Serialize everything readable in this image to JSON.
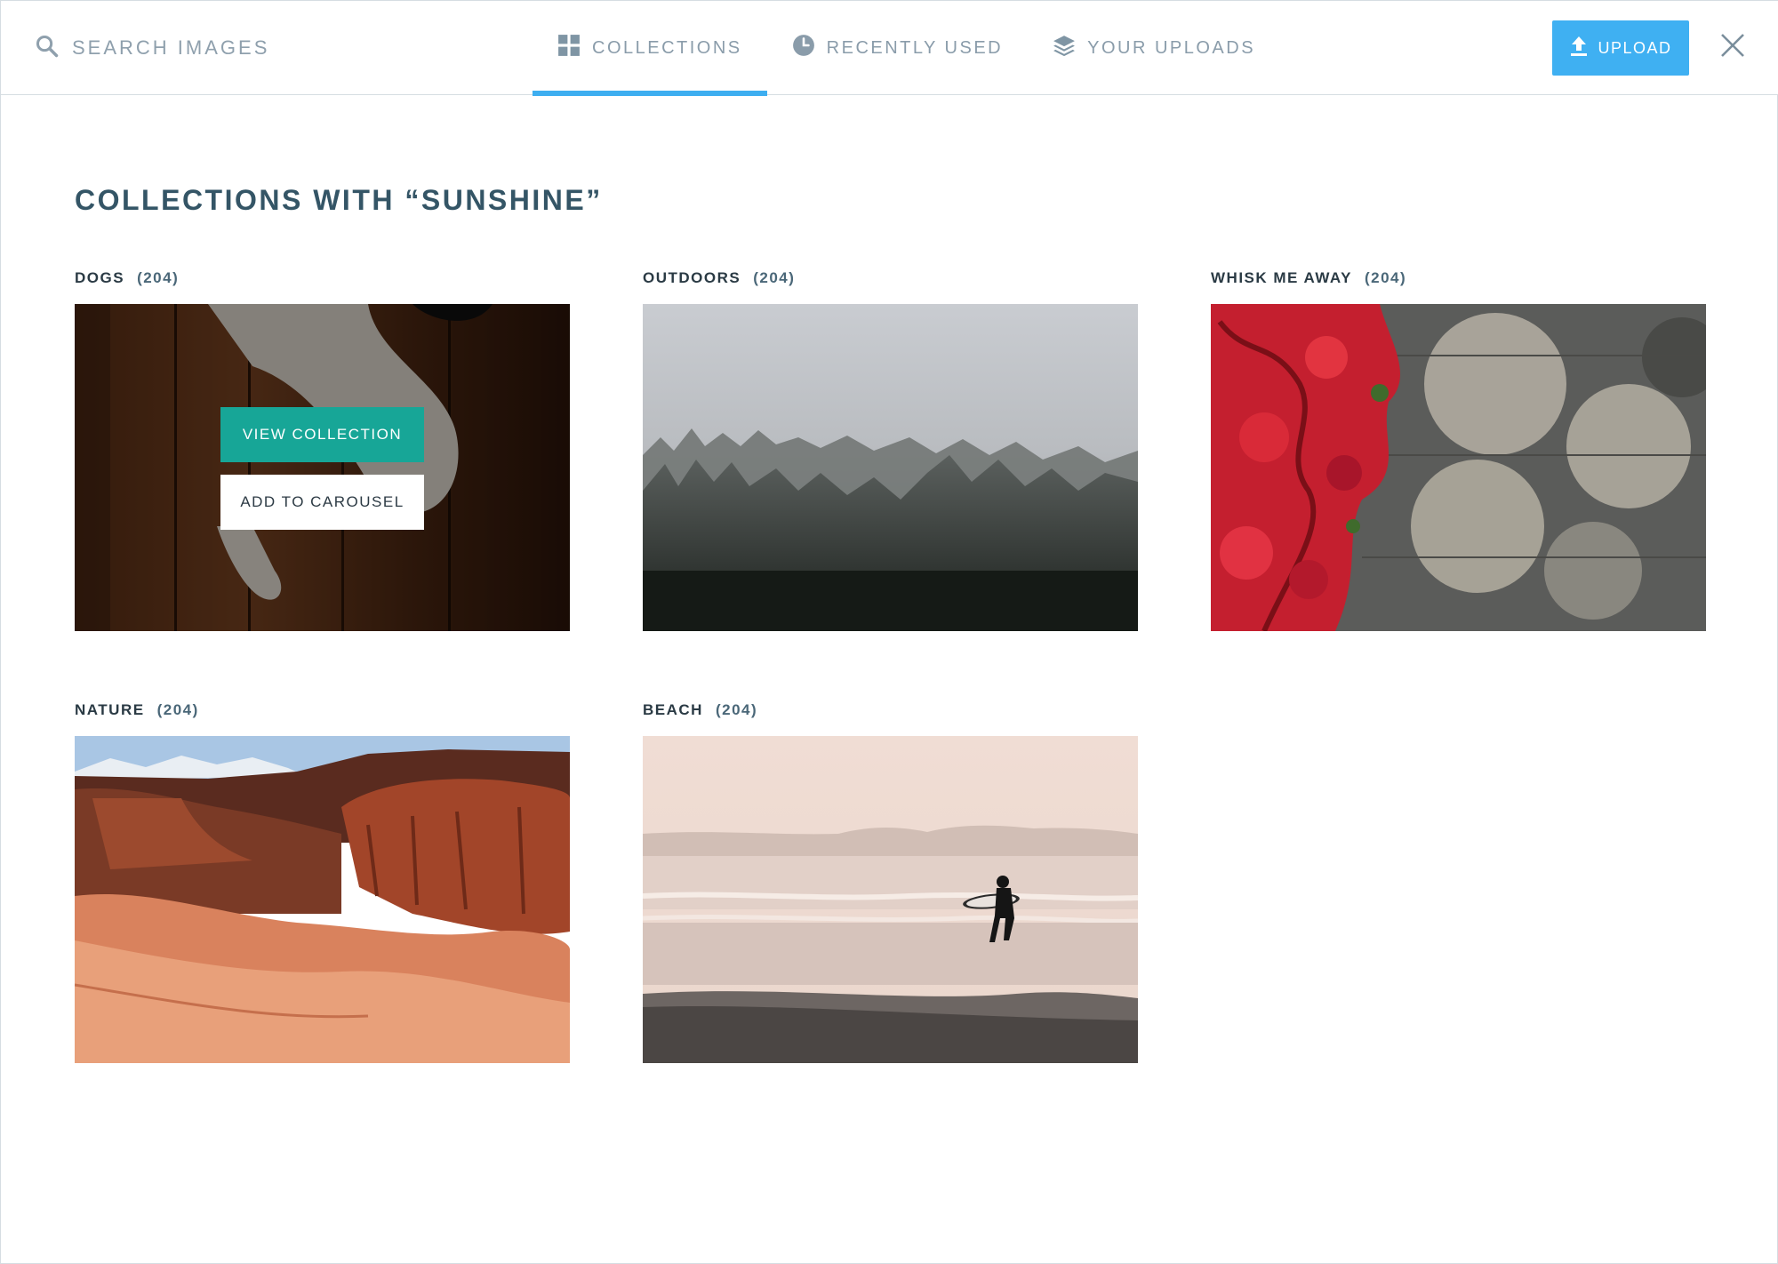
{
  "search": {
    "placeholder": "SEARCH IMAGES"
  },
  "tabs": [
    {
      "label": "COLLECTIONS",
      "icon": "grid-icon",
      "active": true
    },
    {
      "label": "RECENTLY USED",
      "icon": "clock-icon",
      "active": false
    },
    {
      "label": "YOUR UPLOADS",
      "icon": "stack-icon",
      "active": false
    }
  ],
  "toolbar": {
    "upload_label": "UPLOAD"
  },
  "page": {
    "title": "COLLECTIONS WITH “SUNSHINE”"
  },
  "collections": [
    {
      "name": "DOGS",
      "count": "(204)",
      "image": "dog-on-wood-floor"
    },
    {
      "name": "OUTDOORS",
      "count": "(204)",
      "image": "misty-forest"
    },
    {
      "name": "WHISK ME AWAY",
      "count": "(204)",
      "image": "red-ivy-on-wall"
    },
    {
      "name": "NATURE",
      "count": "(204)",
      "image": "red-rock-canyon"
    },
    {
      "name": "BEACH",
      "count": "(204)",
      "image": "surfer-on-beach"
    }
  ],
  "hover_actions": {
    "view_label": "VIEW COLLECTION",
    "add_label": "ADD TO CAROUSEL"
  },
  "colors": {
    "accent": "#3fb0f2",
    "view_button": "#17a697",
    "title": "#345566"
  }
}
